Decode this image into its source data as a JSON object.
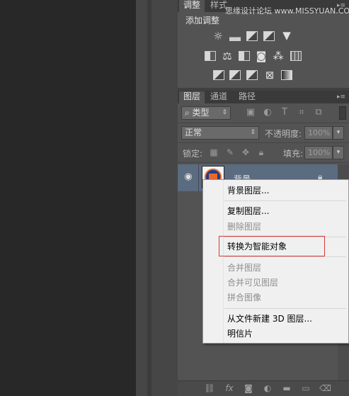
{
  "adjust_panel": {
    "tabs": [
      "调整",
      "样式"
    ],
    "title": "添加调整"
  },
  "watermark": "思缘设计论坛 www.MISSYUAN.COM",
  "layers_panel": {
    "tabs": [
      "图层",
      "通道",
      "路径"
    ],
    "filter_kind": "类型",
    "filter_icons": [
      "image-filter-icon",
      "adjustment-filter-icon",
      "type-filter-icon",
      "shape-filter-icon",
      "smart-object-filter-icon"
    ],
    "blend_mode": "正常",
    "opacity_label": "不透明度:",
    "opacity_value": "100%",
    "lock_label": "锁定:",
    "fill_label": "填充:",
    "fill_value": "100%",
    "layer": {
      "name": "背景",
      "visible": true,
      "locked": true
    },
    "bottom_icons": [
      "link-icon",
      "fx-icon",
      "mask-icon",
      "adjustment-layer-icon",
      "group-folder-icon",
      "new-layer-icon",
      "trash-icon"
    ]
  },
  "context_menu": {
    "items": [
      {
        "label": "背景图层...",
        "enabled": true
      },
      {
        "label": "复制图层...",
        "enabled": true
      },
      {
        "label": "删除图层",
        "enabled": false
      },
      {
        "label": "转换为智能对象",
        "enabled": true,
        "highlighted": true
      },
      {
        "label": "合并图层",
        "enabled": false
      },
      {
        "label": "合并可见图层",
        "enabled": false
      },
      {
        "label": "拼合图像",
        "enabled": false
      },
      {
        "label": "从文件新建 3D 图层...",
        "enabled": true
      },
      {
        "label": "明信片",
        "enabled": true
      }
    ]
  }
}
